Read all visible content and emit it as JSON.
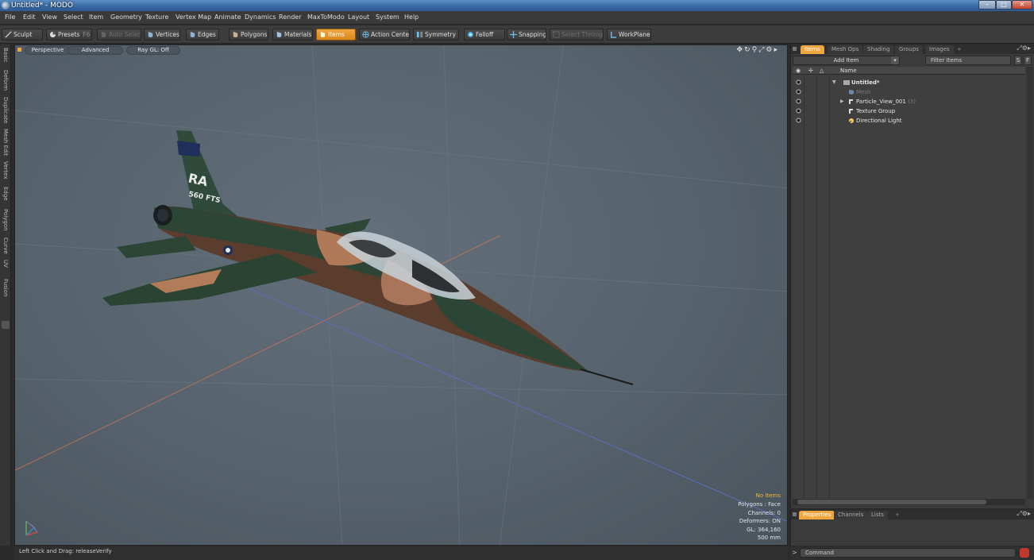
{
  "window": {
    "title": "Untitled* - MODO"
  },
  "menu": [
    "File",
    "Edit",
    "View",
    "Select",
    "Item",
    "Geometry",
    "Texture",
    "Vertex Map",
    "Animate",
    "Dynamics",
    "Render",
    "MaxToModo",
    "Layout",
    "System",
    "Help"
  ],
  "toolbar": {
    "sculpt": "Sculpt",
    "presets": "Presets",
    "presets_key": "F6",
    "auto_select": "Auto Select",
    "vertices": "Vertices",
    "edges": "Edges",
    "polygons": "Polygons",
    "materials": "Materials",
    "items": "Items",
    "action_center": "Action Center",
    "symmetry": "Symmetry",
    "falloff": "Falloff",
    "snapping": "Snapping",
    "select_through": "Select Through",
    "workplane": "WorkPlane"
  },
  "left_tabs": [
    "Basic",
    "Deform",
    "Duplicate",
    "Mesh Edit",
    "Vertex",
    "Edge",
    "Polygon",
    "Curve",
    "UV",
    "Fusion"
  ],
  "viewport": {
    "view_mode": "Perspective",
    "shading": "Advanced",
    "raygl": "Ray GL: Off",
    "info": {
      "selection": "No Items",
      "polygons": "Polygons : Face",
      "channels": "Channels: 0",
      "deformers": "Deformers: ON",
      "gl": "GL: 364,160",
      "scale": "500 mm"
    },
    "aircraft": {
      "tail_code": "RA",
      "unit": "560 FTS"
    }
  },
  "status": {
    "hint": "Left Click and Drag:  releaseVerify"
  },
  "items_panel": {
    "tabs": [
      "Items",
      "Mesh Ops",
      "Shading",
      "Groups",
      "Images"
    ],
    "add_item": "Add Item",
    "filter_placeholder": "Filter Items",
    "s_btn": "S",
    "f_btn": "F",
    "col_name": "Name",
    "tree": [
      {
        "label": "Untitled*",
        "kind": "scene"
      },
      {
        "label": "Mesh",
        "kind": "mesh"
      },
      {
        "label": "Particle_View_001",
        "count": "(3)",
        "kind": "group"
      },
      {
        "label": "Texture Group",
        "kind": "group"
      },
      {
        "label": "Directional Light",
        "kind": "light"
      }
    ]
  },
  "properties_panel": {
    "tabs": [
      "Properties",
      "Channels",
      "Lists"
    ]
  },
  "command": {
    "placeholder": "Command"
  },
  "colors": {
    "accent": "#f0a63f",
    "viewport_bg": "#56626c",
    "panel_bg": "#3b3b3b"
  }
}
